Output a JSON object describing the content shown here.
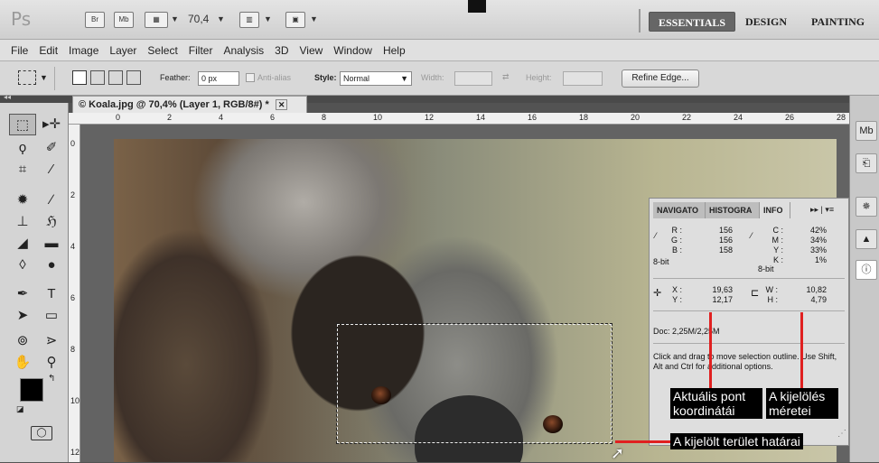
{
  "app": {
    "logo": "Ps",
    "br": "Br",
    "mb": "Mb",
    "zoom": "70,4"
  },
  "workspaces": [
    {
      "label": "ESSENTIALS",
      "active": true
    },
    {
      "label": "DESIGN",
      "active": false
    },
    {
      "label": "PAINTING",
      "active": false
    }
  ],
  "menu": [
    "File",
    "Edit",
    "Image",
    "Layer",
    "Select",
    "Filter",
    "Analysis",
    "3D",
    "View",
    "Window",
    "Help"
  ],
  "options": {
    "feather_label": "Feather:",
    "feather_value": "0 px",
    "antialias_label": "Anti-alias",
    "style_label": "Style:",
    "style_value": "Normal",
    "width_label": "Width:",
    "height_label": "Height:",
    "refine_edge": "Refine Edge..."
  },
  "document": {
    "tab_title": "© Koala.jpg @ 70,4% (Layer 1, RGB/8#) *",
    "close": "✕"
  },
  "rulers": {
    "horizontal": [
      "0",
      "2",
      "4",
      "6",
      "8",
      "10",
      "12",
      "14",
      "16",
      "18",
      "20",
      "22",
      "24",
      "26",
      "28"
    ],
    "vertical": [
      "0",
      "2",
      "4",
      "6",
      "8",
      "10",
      "12"
    ]
  },
  "panel": {
    "tabs": [
      {
        "label": "NAVIGATO",
        "active": false
      },
      {
        "label": "HISTOGRA",
        "active": false
      },
      {
        "label": "INFO",
        "active": true
      }
    ],
    "rgb": {
      "r_label": "R :",
      "r": "156",
      "g_label": "G :",
      "g": "156",
      "b_label": "B :",
      "b": "158",
      "bit": "8-bit"
    },
    "cmyk": {
      "c_label": "C :",
      "c": "42%",
      "m_label": "M :",
      "m": "34%",
      "y_label": "Y :",
      "y": "33%",
      "k_label": "K :",
      "k": "1%",
      "bit": "8-bit"
    },
    "pos": {
      "x_label": "X :",
      "x": "19,63",
      "y_label": "Y :",
      "y": "12,17"
    },
    "size": {
      "w_label": "W :",
      "w": "10,82",
      "h_label": "H :",
      "h": "4,79"
    },
    "doc": "Doc: 2,25M/2,25M",
    "help": "Click and drag to move selection outline.  Use Shift, Alt and Ctrl for additional options."
  },
  "annotations": {
    "coords": "Aktuális pont koordinátái",
    "size": "A kijelölés méretei",
    "border": "A kijelölt terület határai"
  },
  "colors": {
    "annotation_line": "#e02020",
    "panel_bg": "#dedede",
    "active_workspace": "#666666"
  }
}
